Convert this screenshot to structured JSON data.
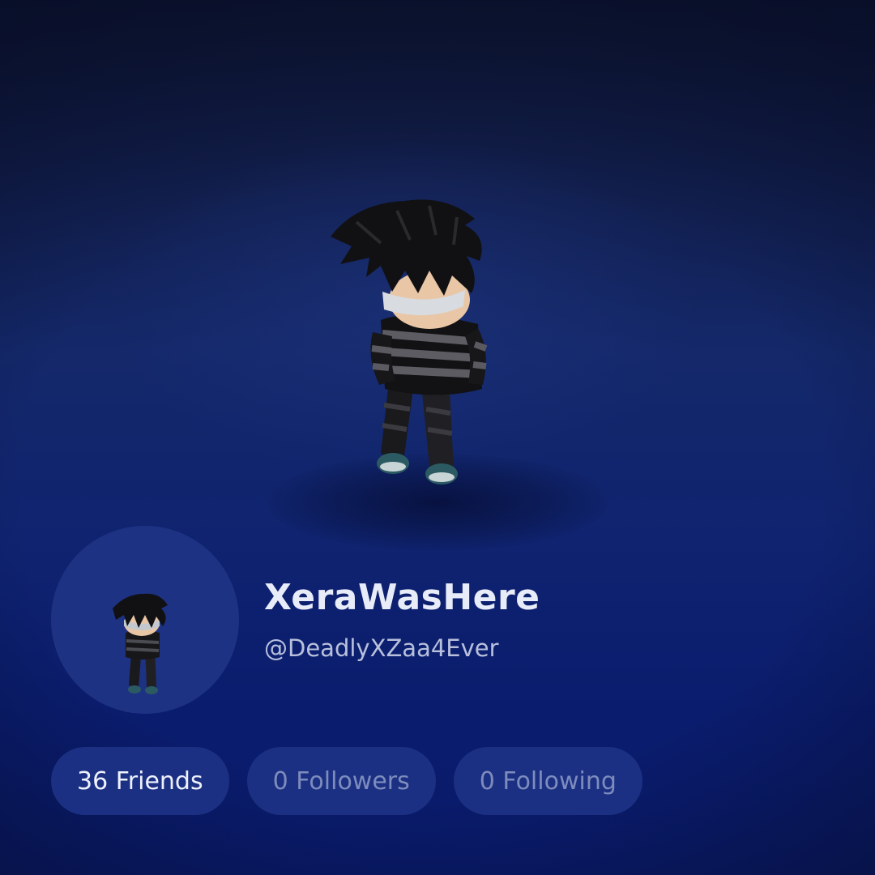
{
  "profile": {
    "display_name": "XeraWasHere",
    "username": "@DeadlyXZaa4Ever"
  },
  "stats": {
    "friends": "36 Friends",
    "followers": "0 Followers",
    "following": "0 Following"
  },
  "colors": {
    "background_top": "#0d1530",
    "background_bottom": "#091a6a",
    "pill_background": "#1b3082",
    "headshot_background": "#1d3282",
    "display_name": "#e8ecf8",
    "username": "#b8c0dc",
    "muted_stat": "#7e8cbd"
  },
  "icons": {
    "avatar_full": "avatar-full-body-icon",
    "avatar_headshot": "avatar-headshot-icon"
  }
}
